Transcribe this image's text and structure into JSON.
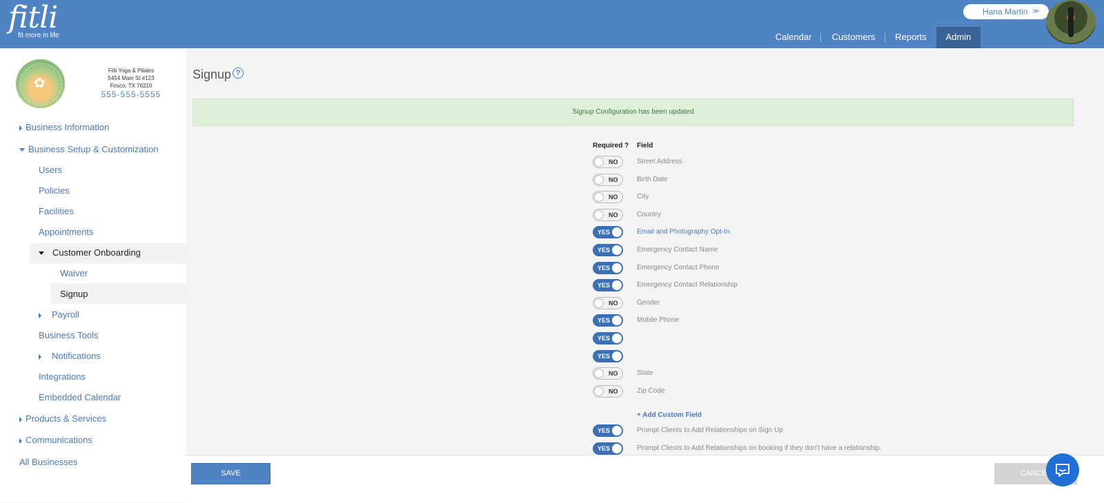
{
  "header": {
    "logo_text": "fitli",
    "logo_tagline": "fit more in life",
    "user_name": "Hana Martin",
    "nav": [
      {
        "label": "Calendar",
        "active": false
      },
      {
        "label": "Customers",
        "active": false
      },
      {
        "label": "Reports",
        "active": false
      },
      {
        "label": "Admin",
        "active": true
      }
    ]
  },
  "business": {
    "logo_text": "FITLI YOGA & PILATES",
    "name": "Fitli Yoga & Pilates",
    "address1": "5454 Main St #123",
    "address2": "Frisco, TX 76210",
    "phone": "555-555-5555"
  },
  "sidebar": {
    "business_information": "Business Information",
    "business_setup": "Business Setup & Customization",
    "users": "Users",
    "policies": "Policies",
    "facilities": "Facilities",
    "appointments": "Appointments",
    "customer_onboarding": "Customer Onboarding",
    "waiver": "Waiver",
    "signup": "Signup",
    "payroll": "Payroll",
    "business_tools": "Business Tools",
    "notifications": "Notifications",
    "integrations": "Integrations",
    "embedded_calendar": "Embedded Calendar",
    "products_services": "Products & Services",
    "communications": "Communications",
    "all_businesses": "All Businesses"
  },
  "main": {
    "title": "Signup",
    "alert": "Signup Configuration has been updated",
    "col_required": "Required ?",
    "col_field": "Field",
    "yes_label": "YES",
    "no_label": "NO",
    "add_custom_field": "+ Add Custom Field",
    "fields": [
      {
        "name": "Street Address",
        "required": false
      },
      {
        "name": "Birth Date",
        "required": false
      },
      {
        "name": "City",
        "required": false
      },
      {
        "name": "Country",
        "required": false
      },
      {
        "name": "Email and Photography Opt-In",
        "required": true
      },
      {
        "name": "Emergency Contact Name",
        "required": true
      },
      {
        "name": "Emergency Contact Phone",
        "required": true
      },
      {
        "name": "Emergency Contact Relationship",
        "required": true
      },
      {
        "name": "Gender",
        "required": false
      },
      {
        "name": "Mobile Phone",
        "required": true
      },
      {
        "name": "",
        "required": true
      },
      {
        "name": "",
        "required": true
      },
      {
        "name": "State",
        "required": false
      },
      {
        "name": "Zip Code",
        "required": false
      }
    ],
    "extra_fields": [
      {
        "name": "Prompt Clients to Add Relationships on Sign Up",
        "required": true
      },
      {
        "name": "Prompt Clients to Add Relationships on booking if they don't have a relationship.",
        "required": true
      }
    ]
  },
  "footer": {
    "save_label": "SAVE",
    "cancel_label": "CANCEL"
  },
  "colors": {
    "header_bg": "#5083c3",
    "active_nav": "#3b6294",
    "toggle_on": "#3c70b5",
    "alert_bg": "#dff0d8",
    "alert_text": "#3c763d",
    "link": "#4a7abf"
  }
}
